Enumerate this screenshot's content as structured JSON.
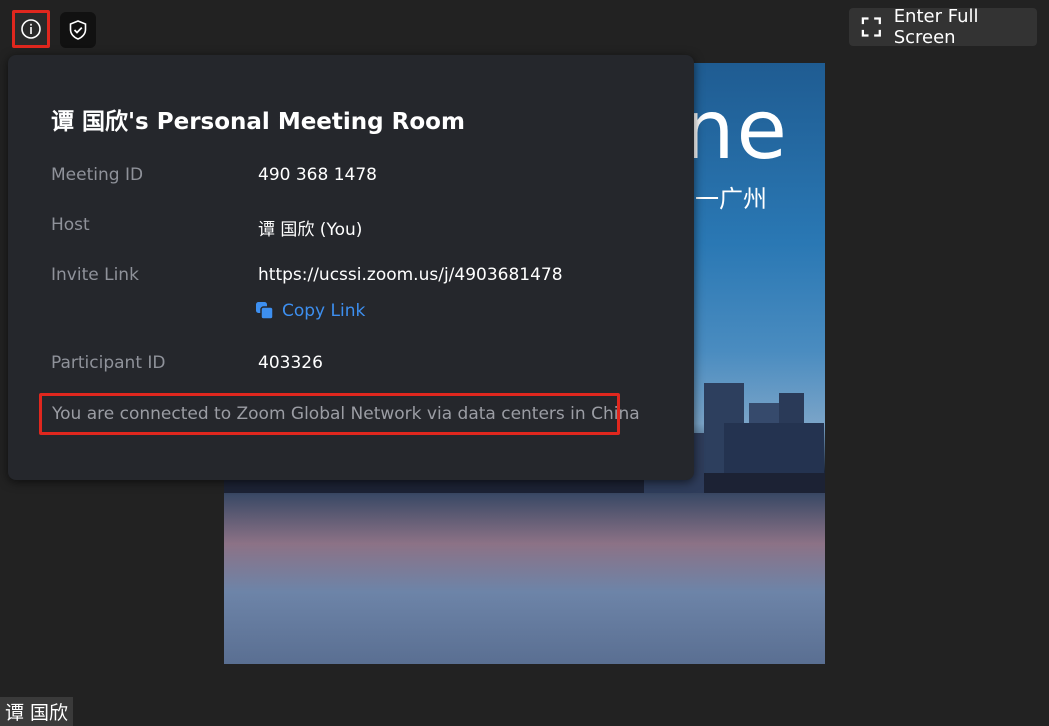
{
  "toolbar": {
    "info_icon": "info-icon",
    "shield_icon": "shield-check-icon",
    "fullscreen_label": "Enter Full Screen",
    "fullscreen_icon": "fullscreen-icon"
  },
  "video": {
    "logo_text": "ne",
    "logo_sub": "一广州"
  },
  "meeting_info": {
    "title": "谭 国欣's Personal Meeting Room",
    "rows": [
      {
        "label": "Meeting ID",
        "value": "490 368 1478"
      },
      {
        "label": "Host",
        "value": "谭 国欣 (You)"
      },
      {
        "label": "Invite Link",
        "value": "https://ucssi.zoom.us/j/4903681478"
      },
      {
        "label": "Participant ID",
        "value": "403326"
      }
    ],
    "copy_link_label": "Copy Link",
    "copy_icon": "copy-icon",
    "network_note": "You are connected to Zoom Global Network via data centers in China"
  },
  "participant": {
    "name": "谭 国欣"
  },
  "colors": {
    "highlight": "#e0271e",
    "link": "#3d8ff0",
    "panel_bg": "#25272c"
  }
}
